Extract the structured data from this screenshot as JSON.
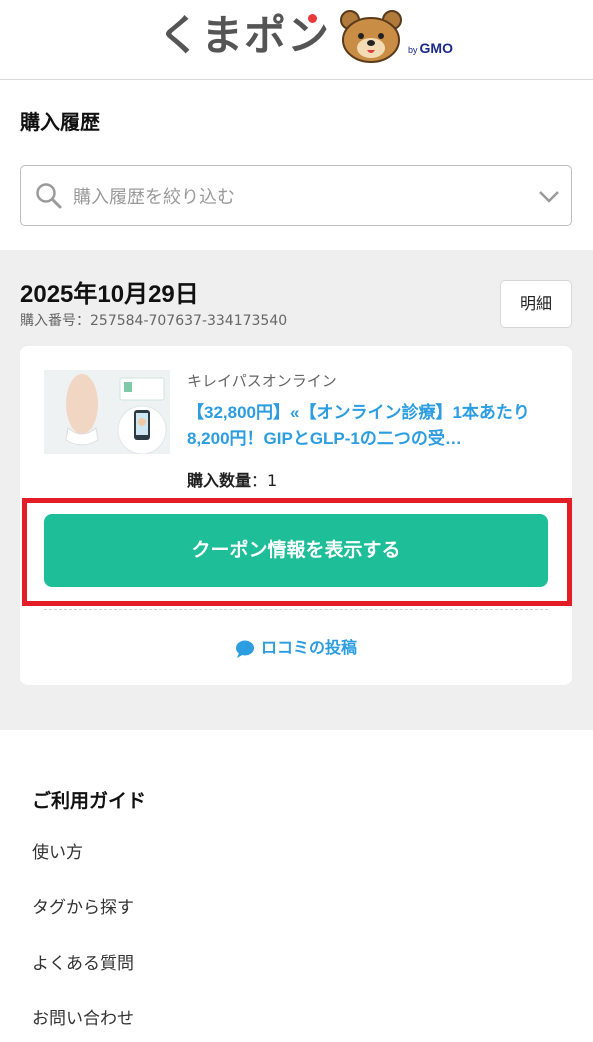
{
  "header": {
    "logo_text_a": "くまポ",
    "logo_text_b": "ン",
    "by_label": "by",
    "gmo_label": "GMO"
  },
  "page_title": "購入履歴",
  "filter": {
    "placeholder": "購入履歴を絞り込む"
  },
  "order": {
    "date": "2025年10月29日",
    "number": "購入番号：257584-707637-334173540",
    "detail_button": "明細",
    "item": {
      "shop": "キレイパスオンライン",
      "title": "【32,800円】«【オンライン診療】1本あたり8,200円！GIPとGLP-1の二つの受…",
      "quantity_label": "購入数量",
      "quantity_sep": "：",
      "quantity_value": "1"
    },
    "coupon_button": "クーポン情報を表示する",
    "review_link": "ロコミの投稿"
  },
  "guide": {
    "title": "ご利用ガイド",
    "items": [
      "使い方",
      "タグから探す",
      "よくある質問",
      "お問い合わせ"
    ]
  },
  "colors": {
    "accent_green": "#1ebe98",
    "link_blue": "#2b9de0",
    "highlight_red": "#e41e26"
  }
}
